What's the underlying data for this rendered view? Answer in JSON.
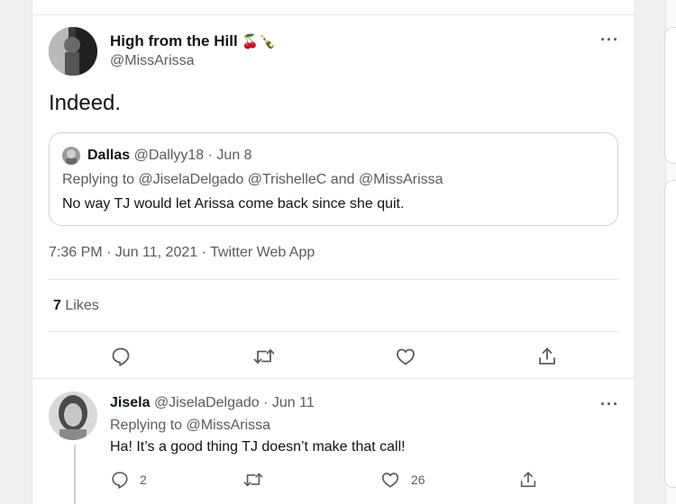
{
  "tweet": {
    "author_name": "High from the Hill",
    "author_emoji": "cherries-icon, champagne-icon",
    "author_handle": "@MissArissa",
    "more_label": "···",
    "text": "Indeed.",
    "timestamp": "7:36 PM · Jun 11, 2021 · Twitter Web App",
    "likes_count": "7",
    "likes_label": "Likes"
  },
  "quoted_tweet": {
    "name": "Dallas",
    "meta": "@Dallyy18 · Jun 8",
    "replying_to": "Replying to @JiselaDelgado @TrishelleC and @MissArissa",
    "text": "No way TJ would let Arissa come back since she quit."
  },
  "actions": [
    "reply-icon",
    "retweet-icon",
    "like-icon",
    "share-icon"
  ],
  "reply_tweet": {
    "name": "Jisela",
    "meta": "@JiselaDelgado · Jun 11",
    "more_label": "···",
    "replying_to": "Replying to @MissArissa",
    "text": "Ha! It’s a good thing TJ doesn’t make that call!",
    "reply_count": "2",
    "like_count": "26"
  },
  "colors": {
    "text": "#0f1419",
    "secondary": "#5b5b5b",
    "border": "#e6e6e6"
  }
}
